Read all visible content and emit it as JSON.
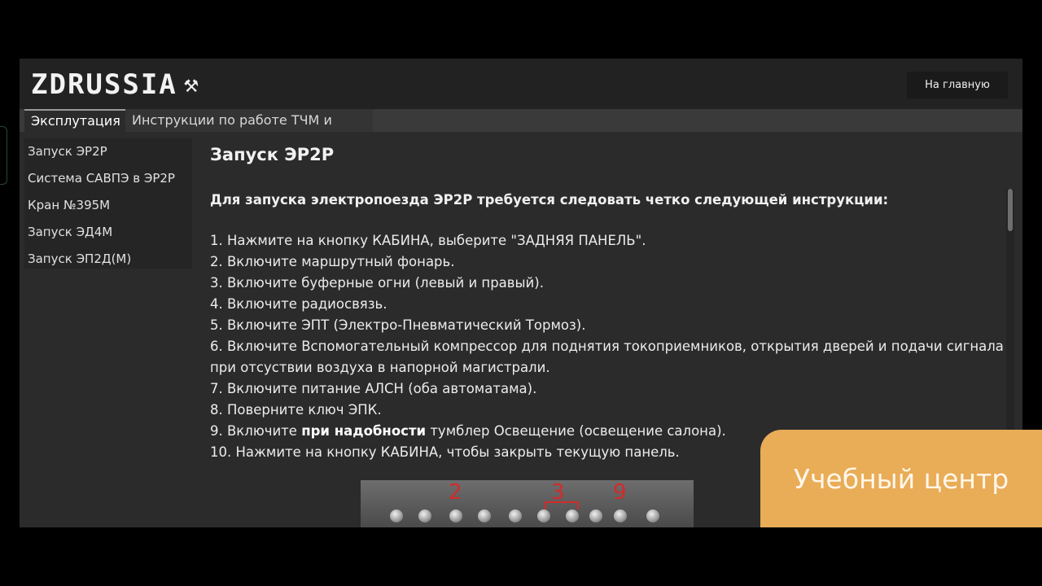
{
  "header": {
    "logo_text": "ZDRUSSIA",
    "logo_icon": "⚒",
    "home_button_label": "На главную"
  },
  "tabs": [
    {
      "label": "Эксплутация",
      "active": true
    },
    {
      "label": "Инструкции по работе ТЧМ и иное",
      "active": false
    }
  ],
  "sidebar": {
    "items": [
      {
        "label": "Запуск ЭР2Р"
      },
      {
        "label": "Система САВПЭ в ЭР2Р"
      },
      {
        "label": "Кран №395М"
      },
      {
        "label": "Запуск ЭД4М"
      },
      {
        "label": "Запуск ЭП2Д(М)"
      }
    ]
  },
  "content": {
    "title": "Запуск ЭР2Р",
    "intro": "Для запуска электропоезда ЭР2Р требуется следовать четко следующей инструкции:",
    "steps": [
      "1. Нажмите на кнопку КАБИНА, выберите \"ЗАДНЯЯ ПАНЕЛЬ\".",
      "2. Включите маршрутный фонарь.",
      "3. Включите буферные огни (левый и правый).",
      "4. Включите радиосвязь.",
      "5. Включите ЭПТ (Электро-Пневматический Тормоз).",
      "6. Включите Вспомогательный компрессор для поднятия  токоприемников, открытия дверей и подачи сигнала при отсуствии воздуха в  напорной магистрали.",
      "7. Включите питание АЛСН (оба автоматама).",
      "8. Поверните ключ ЭПК."
    ],
    "step9": {
      "prefix": "9. Включите ",
      "bold": "при надобности",
      "suffix": " тумблер Освещение (освещение салона)."
    },
    "step10": "10. Нажмите на кнопку КАБИНА, чтобы закрыть текущую панель.",
    "photo_marks": [
      "2",
      "3",
      "9"
    ]
  },
  "overlay": {
    "label": "Учебный центр",
    "color": "#e9ac57"
  }
}
